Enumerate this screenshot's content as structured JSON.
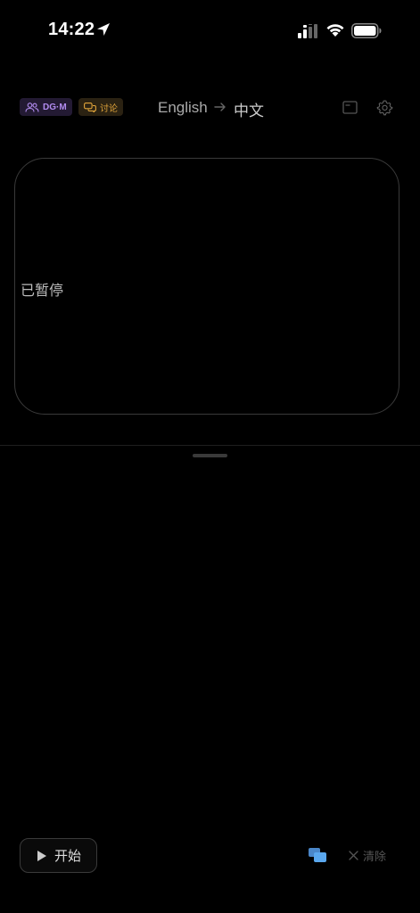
{
  "status_bar": {
    "time": "14:22",
    "icons": [
      "location-arrow-icon",
      "signal-icon",
      "wifi-icon",
      "battery-icon"
    ]
  },
  "toolbar": {
    "group_badge": "DG·M",
    "discuss_badge": "讨论",
    "source_language": "English",
    "target_language": "中文",
    "icons": [
      "window-icon",
      "settings-icon"
    ]
  },
  "card": {
    "status": "已暂停"
  },
  "bottom": {
    "start_label": "开始",
    "clear_label": "清除"
  },
  "colors": {
    "background": "#000000",
    "group_badge_accent": "#b28cf0",
    "discuss_badge_accent": "#e0a43a",
    "bubbles_accent": "#5aa7ee"
  }
}
